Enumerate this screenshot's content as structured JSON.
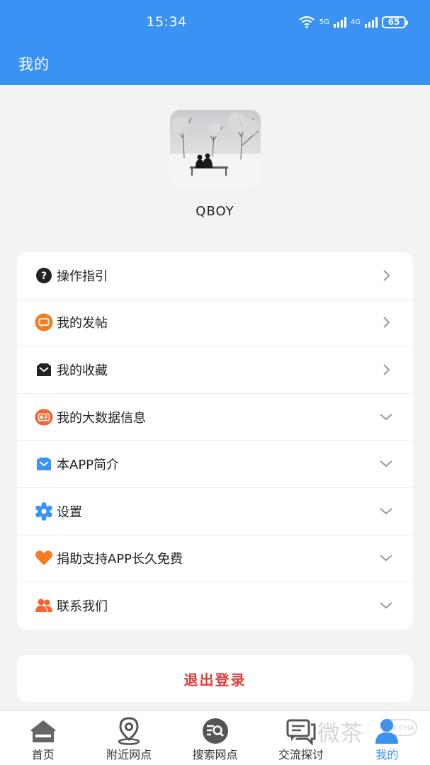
{
  "status_bar": {
    "time": "15:34",
    "network_1": "5G",
    "network_2": "4G",
    "battery": "65"
  },
  "header": {
    "title": "我的"
  },
  "profile": {
    "username": "QBOY"
  },
  "menu": {
    "items": [
      {
        "label": "操作指引",
        "icon": "question-circle-icon",
        "indicator": "chevron-right"
      },
      {
        "label": "我的发帖",
        "icon": "chat-bubble-icon",
        "indicator": "chevron-right"
      },
      {
        "label": "我的收藏",
        "icon": "collection-box-icon",
        "indicator": "chevron-right"
      },
      {
        "label": "我的大数据信息",
        "icon": "id-card-icon",
        "indicator": "chevron-down"
      },
      {
        "label": "本APP简介",
        "icon": "info-box-icon",
        "indicator": "chevron-down"
      },
      {
        "label": "设置",
        "icon": "gear-icon",
        "indicator": "chevron-down"
      },
      {
        "label": "捐助支持APP长久免费",
        "icon": "heart-icon",
        "indicator": "chevron-down"
      },
      {
        "label": "联系我们",
        "icon": "contacts-icon",
        "indicator": "chevron-down"
      }
    ]
  },
  "logout": {
    "label": "退出登录"
  },
  "tabbar": {
    "tabs": [
      {
        "label": "首页",
        "icon": "home-icon"
      },
      {
        "label": "附近网点",
        "icon": "location-pin-icon"
      },
      {
        "label": "搜索网点",
        "icon": "search-list-icon"
      },
      {
        "label": "交流探讨",
        "icon": "chat-icon"
      },
      {
        "label": "我的",
        "icon": "user-icon",
        "active": true
      }
    ]
  },
  "watermark": {
    "text": "微茶",
    "badge": "WX CHA"
  },
  "colors": {
    "primary": "#3a92f5",
    "logout_red": "#e53935",
    "orange": "#f57c1f",
    "background": "#f2f3f5"
  }
}
